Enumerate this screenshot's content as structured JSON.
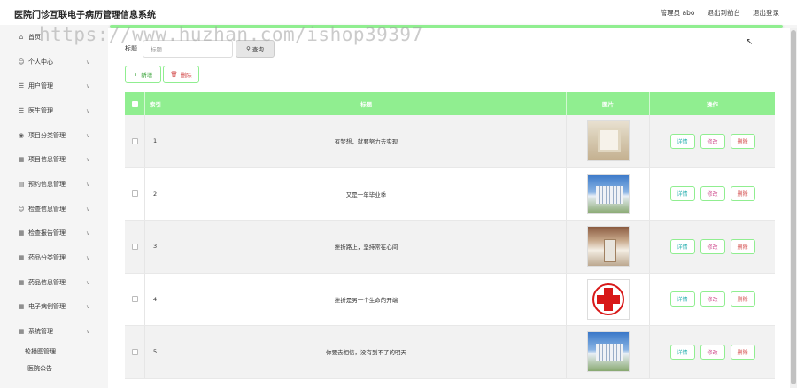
{
  "header": {
    "app_title": "医院门诊互联电子病历管理信息系统",
    "user_role": "管理员 abo",
    "exit_backend": "退出到前台",
    "logout": "退出登录"
  },
  "watermark": "https://www.huzhan.com/ishop39397",
  "sidebar": {
    "items": [
      {
        "label": "首页",
        "icon": "home-icon"
      },
      {
        "label": "个人中心",
        "icon": "user-icon"
      },
      {
        "label": "用户管理",
        "icon": "list-icon"
      },
      {
        "label": "医生管理",
        "icon": "list-icon"
      },
      {
        "label": "项目分类管理",
        "icon": "location-icon"
      },
      {
        "label": "项目信息管理",
        "icon": "grid-icon"
      },
      {
        "label": "预约信息管理",
        "icon": "calendar-icon"
      },
      {
        "label": "检查信息管理",
        "icon": "user-icon"
      },
      {
        "label": "检查报告管理",
        "icon": "grid-icon"
      },
      {
        "label": "药品分类管理",
        "icon": "grid-icon"
      },
      {
        "label": "药品信息管理",
        "icon": "grid-icon"
      },
      {
        "label": "电子病例管理",
        "icon": "grid-icon"
      },
      {
        "label": "系统管理",
        "icon": "grid-icon"
      }
    ],
    "sub_items": [
      "轮播图管理",
      "医院公告"
    ]
  },
  "search": {
    "label": "标题",
    "placeholder": "标题",
    "button_label": "查询"
  },
  "actions": {
    "add_label": "新增",
    "delete_label": "删除"
  },
  "table": {
    "headers": {
      "index": "索引",
      "title": "标题",
      "image": "图片",
      "ops": "操作"
    },
    "rows": [
      {
        "index": "1",
        "title": "有梦想，就要努力去实现",
        "image": "corridor-photo"
      },
      {
        "index": "2",
        "title": "又是一年毕业季",
        "image": "building-photo"
      },
      {
        "index": "3",
        "title": "挫折路上，坚持常在心间",
        "image": "lobby-photo"
      },
      {
        "index": "4",
        "title": "挫折是另一个生命的开端",
        "image": "red-cross-logo"
      },
      {
        "index": "5",
        "title": "你要去相信，没有到不了的明天",
        "image": "building-photo"
      }
    ],
    "op_labels": {
      "detail": "详情",
      "edit": "修改",
      "delete": "删除"
    }
  },
  "colors": {
    "accent": "#90ee90",
    "danger": "#d04040"
  }
}
